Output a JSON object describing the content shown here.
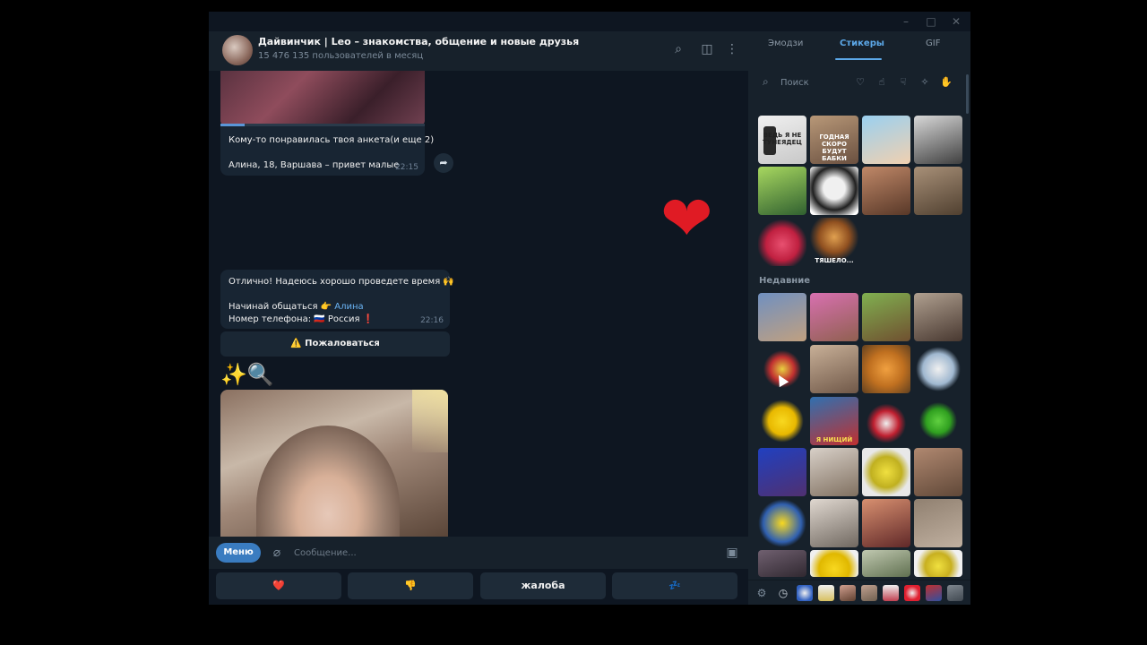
{
  "chat": {
    "title": "Дайвинчик | Leo – знакомства, общение и новые друзья",
    "subtitle": "15 476 135 пользователей в месяц"
  },
  "messages": {
    "m1_line1": "Кому-то понравилась твоя анкета(и еще 2)",
    "m1_line2": "Алина, 18, Варшава – привет малые",
    "m1_time": "22:15",
    "m2_line1": "Отлично! Надеюсь хорошо проведете время 🙌",
    "m2_line2_prefix": "Начинай общаться 👉 ",
    "m2_link": "Алина",
    "m2_line3": "Номер телефона: 🇷🇺 Россия ❗",
    "m2_time": "22:16",
    "report_button": "⚠️ Пожаловаться",
    "big_heart": "❤",
    "sparkle_emoji": "✨🔍"
  },
  "input": {
    "menu_label": "Меню",
    "placeholder": "Сообщение..."
  },
  "keyboard": {
    "buttons": [
      "❤️",
      "👎",
      "жалоба",
      "💤"
    ]
  },
  "panel": {
    "tabs": [
      "Эмодзи",
      "Стикеры",
      "GIF"
    ],
    "active_tab": "Стикеры",
    "search_placeholder": "Поиск",
    "recent_label": "Недавние",
    "sticker_captions": {
      "s1": "ВЕДЬ Я НЕ ТУНЕЯДЕЦ",
      "s2": "ГОДНАЯ СКОРО БУДУТ БАБКИ",
      "s10": "ТЯШЕЛО...",
      "s18": "Я НИЩИЙ"
    }
  },
  "colors": {
    "window_bg": "#0e1621",
    "panel_bg": "#17212b",
    "bubble_bg": "#182533",
    "accent": "#5ca8e8",
    "link": "#6ab3f3"
  }
}
